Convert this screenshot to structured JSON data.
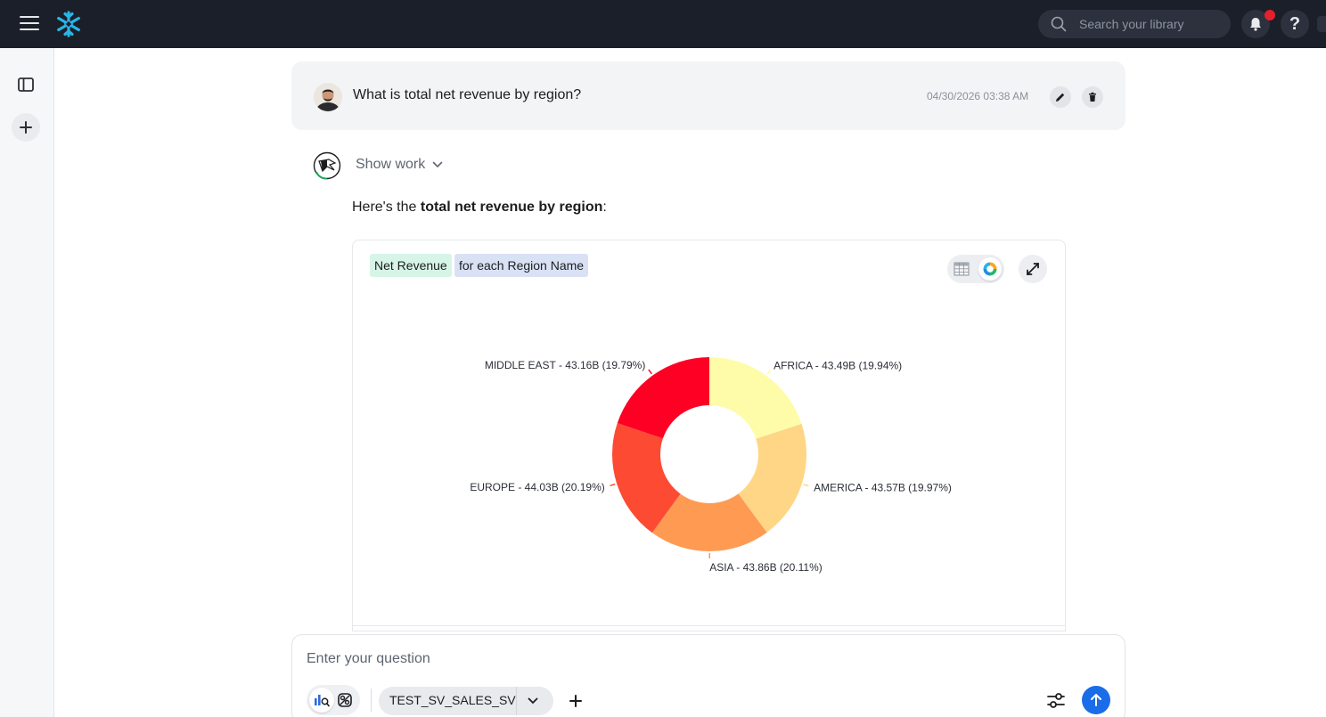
{
  "topbar": {
    "search_placeholder": "Search your library",
    "icons": [
      "menu-icon",
      "snowflake-logo",
      "search-icon",
      "bell-icon",
      "help-icon"
    ],
    "notification_dot_color": "#e3202b"
  },
  "sidebar": {
    "icons": [
      "panel-toggle-icon",
      "plus-icon"
    ]
  },
  "question": {
    "text": "What is total net revenue by region?",
    "timestamp": "04/30/2026 03:38 AM",
    "icons": [
      "edit-icon",
      "trash-icon"
    ]
  },
  "response": {
    "show_work_label": "Show work",
    "answer_prefix": "Here's the ",
    "answer_bold": "total net revenue by region",
    "answer_suffix": ":"
  },
  "chart_card": {
    "measure_tag": "Net Revenue",
    "dimension_tag": "for each Region Name",
    "icons": [
      "table-view-icon",
      "donut-chart-icon",
      "expand-icon"
    ]
  },
  "chart_data": {
    "type": "pie",
    "donut": true,
    "categories": [
      "AFRICA",
      "AMERICA",
      "ASIA",
      "EUROPE",
      "MIDDLE EAST"
    ],
    "values": [
      43.49,
      43.57,
      43.86,
      44.03,
      43.16
    ],
    "labels": [
      "AFRICA - 43.49B (19.94%)",
      "AMERICA - 43.57B (19.97%)",
      "ASIA - 43.86B (20.11%)",
      "EUROPE - 44.03B (20.19%)",
      "MIDDLE EAST - 43.16B (19.79%)"
    ],
    "colors": [
      "#fefca9",
      "#fed685",
      "#fe9a52",
      "#fd4a33",
      "#fe0023"
    ]
  },
  "composer": {
    "placeholder": "Enter your question",
    "model_name": "TEST_SV_SALES_SV",
    "send_button_color": "#1a6ce8",
    "icons": [
      "analyst-mode-icon",
      "agent-mode-icon",
      "chevron-down-icon",
      "plus-icon",
      "settings-sliders-icon",
      "send-arrow-icon"
    ]
  }
}
